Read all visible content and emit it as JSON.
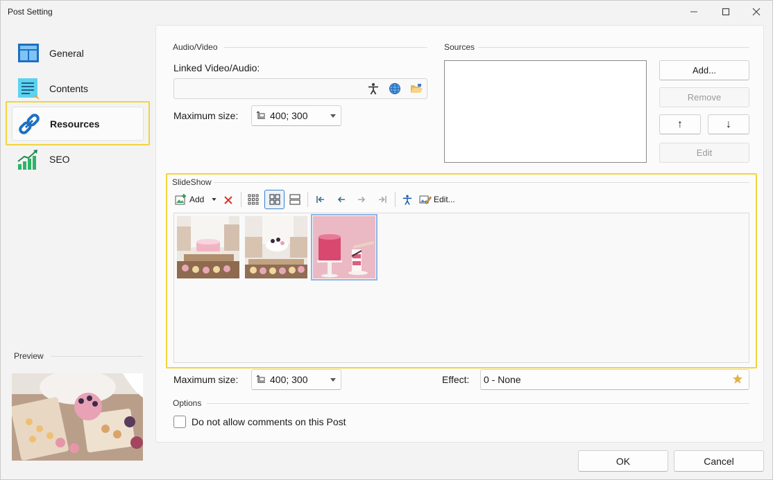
{
  "window": {
    "title": "Post Setting"
  },
  "sidebar": {
    "items": [
      {
        "label": "General",
        "icon": "layout-icon"
      },
      {
        "label": "Contents",
        "icon": "document-icon"
      },
      {
        "label": "Resources",
        "icon": "link-icon",
        "active": true
      },
      {
        "label": "SEO",
        "icon": "growth-chart-icon"
      }
    ],
    "preview_label": "Preview"
  },
  "audio_video": {
    "group_label": "Audio/Video",
    "linked_label": "Linked Video/Audio:",
    "linked_value": "",
    "max_size_label": "Maximum size:",
    "max_size_value": "400; 300"
  },
  "sources": {
    "group_label": "Sources",
    "add_label": "Add...",
    "remove_label": "Remove",
    "up_label": "↑",
    "down_label": "↓",
    "edit_label": "Edit"
  },
  "slideshow": {
    "group_label": "SlideShow",
    "toolbar": {
      "add_label": "Add",
      "edit_label": "Edit..."
    },
    "thumbnails": [
      "photo-chef-cake",
      "photo-chef-cupcakes",
      "photo-pink-cake"
    ],
    "selected_index": 2,
    "max_size_label": "Maximum size:",
    "max_size_value": "400; 300",
    "effect_label": "Effect:",
    "effect_value": "0 - None"
  },
  "options": {
    "group_label": "Options",
    "no_comments_label": "Do not allow comments on this Post",
    "no_comments_checked": false
  },
  "footer": {
    "ok_label": "OK",
    "cancel_label": "Cancel"
  },
  "colors": {
    "highlight": "#f2d43a",
    "accent": "#3b7fc4",
    "star": "#e2b24a"
  }
}
